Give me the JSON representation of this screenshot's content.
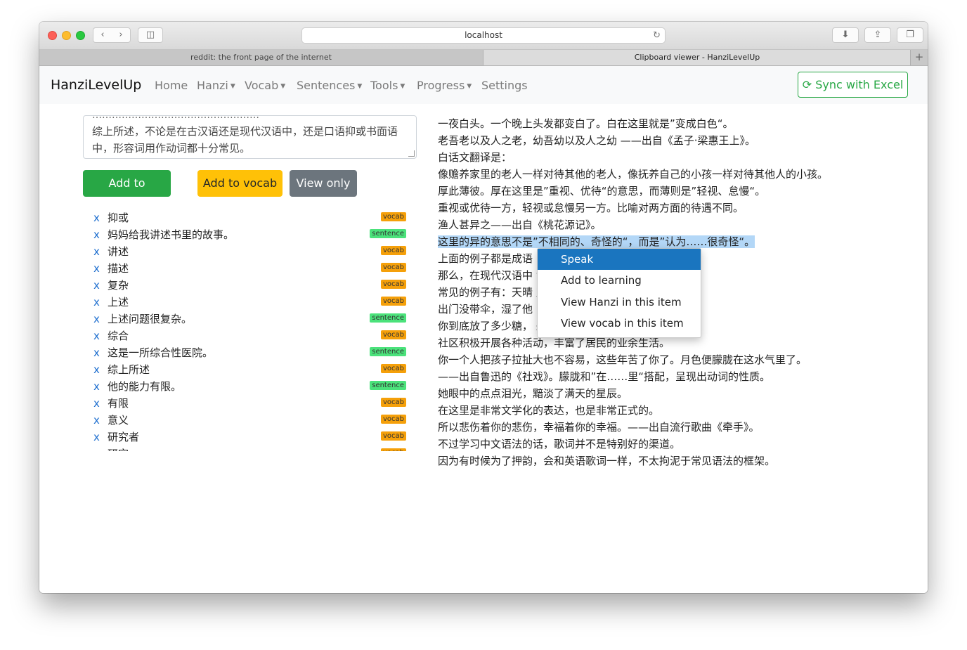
{
  "browser": {
    "url": "localhost",
    "tabs": [
      "reddit: the front page of the internet",
      "Clipboard viewer - HanziLevelUp"
    ]
  },
  "navbar": {
    "brand": "HanziLevelUp",
    "links": [
      "Home",
      "Hanzi",
      "Vocab",
      "Sentences",
      "Tools",
      "Progress",
      "Settings"
    ],
    "sync_label": "Sync with Excel"
  },
  "input": {
    "clipped_line": "……………………………………………",
    "text": "综上所述，不论是在古汉语还是现代汉语中，还是口语抑或书面语中，形容词用作动词都十分常见。"
  },
  "actions": {
    "add_sentences": "Add to sentences",
    "add_vocab": "Add to vocab",
    "view_only": "View only"
  },
  "items": [
    {
      "x": "x",
      "text": "抑或",
      "type": "vocab"
    },
    {
      "x": "x",
      "text": "妈妈给我讲述书里的故事。",
      "type": "sentence"
    },
    {
      "x": "x",
      "text": "讲述",
      "type": "vocab"
    },
    {
      "x": "x",
      "text": "描述",
      "type": "vocab"
    },
    {
      "x": "x",
      "text": "复杂",
      "type": "vocab"
    },
    {
      "x": "x",
      "text": "上述",
      "type": "vocab"
    },
    {
      "x": "x",
      "text": "上述问题很复杂。",
      "type": "sentence"
    },
    {
      "x": "x",
      "text": "综合",
      "type": "vocab"
    },
    {
      "x": "x",
      "text": "这是一所综合性医院。",
      "type": "sentence"
    },
    {
      "x": "x",
      "text": "综上所述",
      "type": "vocab"
    },
    {
      "x": "x",
      "text": "他的能力有限。",
      "type": "sentence"
    },
    {
      "x": "x",
      "text": "有限",
      "type": "vocab"
    },
    {
      "x": "x",
      "text": "意义",
      "type": "vocab"
    },
    {
      "x": "x",
      "text": "研究者",
      "type": "vocab"
    },
    {
      "x": "x",
      "text": "研究",
      "type": "vocab"
    }
  ],
  "reading_lines": [
    "一夜白头。一个晚上头发都变白了。白在这里就是”变成白色“。",
    "老吾老以及人之老，幼吾幼以及人之幼 ——出自《孟子·梁惠王上》。",
    "白话文翻译是：",
    "像赡养家里的老人一样对待其他的老人，像抚养自己的小孩一样对待其他人的小孩。",
    "厚此薄彼。厚在这里是”重视、优待“的意思，而薄则是”轻视、怠慢“。",
    "重视或优待一方，轻视或怠慢另一方。比喻对两方面的待遇不同。",
    "渔人甚异之——出自《桃花源记》。",
    "这里的异的意思不是”不相同的、奇怪的“，而是”认为……很奇怪“。",
    "上面的例子都是成语",
    "那么，在现代汉语中                                    肯定的，不论是口语还是书面语。",
    "常见的例子有：天晴                                    宜你了。",
    "出门没带伞，湿了他",
    "你到底放了多少糖，                                    来及喝水，渴死我了。",
    "社区积极开展各种活动，丰富了居民的业余生活。",
    "你一个人把孩子拉扯大也不容易，这些年苦了你了。月色便朦胧在这水气里了。",
    "——出自鲁迅的《社戏》。朦胧和”在……里“搭配，呈现出动词的性质。",
    "她眼中的点点泪光，黯淡了满天的星辰。",
    "在这里是非常文学化的表达，也是非常正式的。",
    "所以悲伤着你的悲伤，幸福着你的幸福。——出自流行歌曲《牵手》。",
    "不过学习中文语法的话，歌词并不是特别好的渠道。",
    "因为有时候为了押韵，会和英语歌词一样，不太拘泥于常见语法的框架。"
  ],
  "context_menu": [
    "Speak",
    "Add to learning",
    "View Hanzi in this item",
    "View vocab in this item"
  ],
  "colors": {
    "accent_green": "#28a745",
    "warning_yellow": "#ffc107",
    "secondary_gray": "#6c757d",
    "menu_highlight": "#1a75bf"
  }
}
